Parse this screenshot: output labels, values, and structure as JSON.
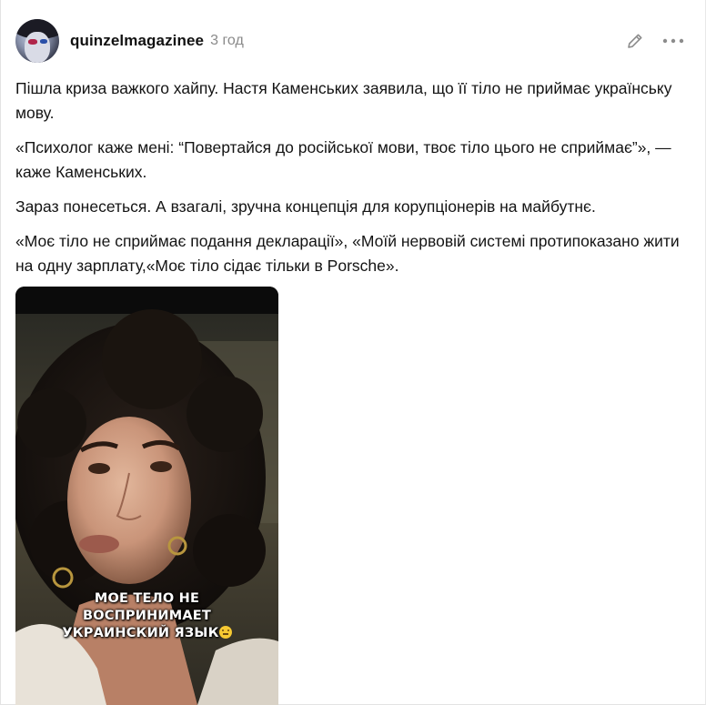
{
  "post": {
    "author": "quinzelmagazinee",
    "time": "3 год",
    "paragraphs": [
      "Пішла криза важкого хайпу. Настя Каменських заявила, що її тіло не приймає українську мову.",
      "«Психолог каже мені: “Повертайся до російської мови, твоє тіло цього не сприймає”», — каже Каменських.",
      "Зараз понесеться. А взагалі, зручна концепція для корупціонерів на майбутнє.",
      "«Моє тіло не сприймає подання декларації», «Моїй нервовій системі протипоказано жити на одну зарплату,«Моє тіло сідає тільки в Porsche»."
    ],
    "video": {
      "caption_lines": [
        "МОЕ ТЕЛО НЕ",
        "ВОСПРИНИМАЕТ",
        "УКРАИНСКИЙ ЯЗЫК"
      ],
      "caption_emoji": "slight-smile-emoji"
    }
  },
  "icons": {
    "edit": "pencil-icon",
    "more": "more-horizontal-icon"
  },
  "colors": {
    "author_text": "#111111",
    "time_text": "#8a8a8a",
    "body_text": "#141414",
    "icon": "#8c8c8c"
  }
}
